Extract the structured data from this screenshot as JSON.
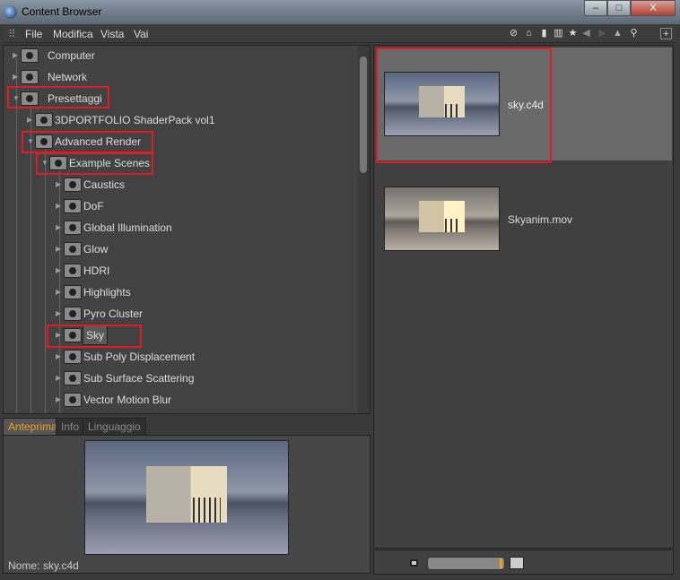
{
  "window": {
    "title": "Content Browser",
    "minimize": "–",
    "maximize": "□",
    "close": "X"
  },
  "menu": [
    "File",
    "Modifica",
    "Vista",
    "Vai"
  ],
  "toolbar_icons": [
    "sync-icon",
    "home-icon",
    "presets-icon",
    "catalog-icon",
    "favorite-icon",
    "back-icon",
    "forward-icon",
    "up-icon",
    "search-icon",
    "new-icon"
  ],
  "tree": [
    {
      "label": "Computer",
      "level": 0
    },
    {
      "label": "Network",
      "level": 0
    },
    {
      "label": "Presettaggi",
      "level": 0
    },
    {
      "label": "3DPORTFOLIO ShaderPack vol1",
      "level": 1
    },
    {
      "label": "Advanced Render",
      "level": 1
    },
    {
      "label": "Example Scenes",
      "level": 2
    },
    {
      "label": "Caustics",
      "level": 3
    },
    {
      "label": "DoF",
      "level": 3
    },
    {
      "label": "Global Illumination",
      "level": 3
    },
    {
      "label": "Glow",
      "level": 3
    },
    {
      "label": "HDRI",
      "level": 3
    },
    {
      "label": "Highlights",
      "level": 3
    },
    {
      "label": "Pyro Cluster",
      "level": 3
    },
    {
      "label": "Sky",
      "level": 3,
      "selected": true
    },
    {
      "label": "Sub Poly Displacement",
      "level": 3
    },
    {
      "label": "Sub Surface Scattering",
      "level": 3
    },
    {
      "label": "Vector Motion Blur",
      "level": 3
    }
  ],
  "info_tabs": [
    "Anteprima",
    "Info",
    "Linguaggio"
  ],
  "preview": {
    "name_label": "Nome:",
    "name_value": "sky.c4d"
  },
  "files": [
    {
      "name": "sky.c4d",
      "selected": true
    },
    {
      "name": "Skyanim.mov"
    }
  ],
  "zoom_slider": {
    "value": 1.0
  },
  "accent": "#e01b24"
}
